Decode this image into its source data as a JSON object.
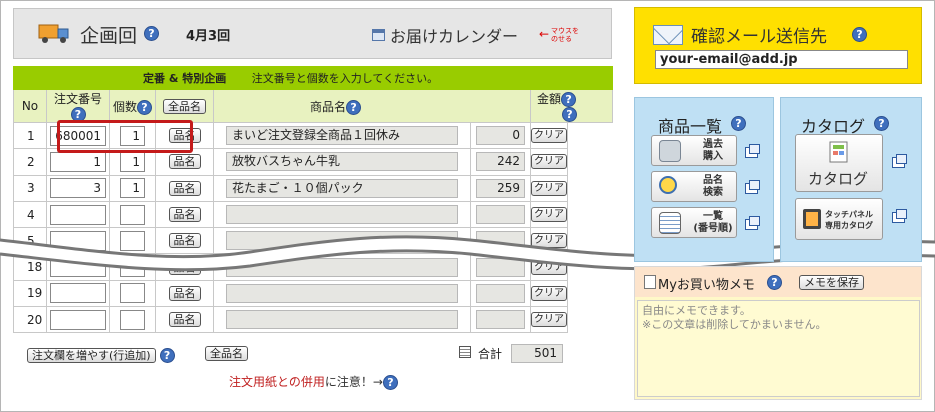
{
  "header": {
    "title": "企画回",
    "edition": "4月3回",
    "calendar_link": "お届けカレンダー",
    "calendar_arrow": "←",
    "calendar_hint": "マウスを\nのせる"
  },
  "order_form": {
    "banner_title": "定番 & 特別企画",
    "banner_instruction": "注文番号と個数を入力してください。",
    "columns": {
      "no": "No",
      "order_number": "注文番号",
      "quantity": "個数",
      "all_names_button": "全品名",
      "product_name": "商品名",
      "amount": "金額"
    },
    "name_button": "品名",
    "clear_button": "クリア",
    "rows": [
      {
        "no": "1",
        "order_number": "680001",
        "quantity": "1",
        "product_name": "まいど注文登録全商品１回休み",
        "amount": "0"
      },
      {
        "no": "2",
        "order_number": "1",
        "quantity": "1",
        "product_name": "放牧バスちゃん牛乳",
        "amount": "242"
      },
      {
        "no": "3",
        "order_number": "3",
        "quantity": "1",
        "product_name": "花たまご・１０個パック",
        "amount": "259"
      },
      {
        "no": "4",
        "order_number": "",
        "quantity": "",
        "product_name": "",
        "amount": ""
      },
      {
        "no": "5",
        "order_number": "",
        "quantity": "",
        "product_name": "",
        "amount": ""
      },
      {
        "no": "18",
        "order_number": "",
        "quantity": "",
        "product_name": "",
        "amount": ""
      },
      {
        "no": "19",
        "order_number": "",
        "quantity": "",
        "product_name": "",
        "amount": ""
      },
      {
        "no": "20",
        "order_number": "",
        "quantity": "",
        "product_name": "",
        "amount": ""
      }
    ],
    "add_rows_button": "注文欄を増やす(行追加)",
    "footer_all_names_button": "全品名",
    "total_label": "合計",
    "total_value": "501",
    "warning_red": "注文用紙との併用",
    "warning_rest": "に注意！→"
  },
  "help_icon": "?",
  "confirm_email": {
    "title": "確認メール送信先",
    "value": "your-email@add.jp"
  },
  "product_list": {
    "title": "商品一覧",
    "buttons": [
      {
        "label_line1": "過去",
        "label_line2": "購入",
        "icon": "basket-icon"
      },
      {
        "label_line1": "品名",
        "label_line2": "検索",
        "icon": "magnifier-icon"
      },
      {
        "label_line1": "一覧",
        "label_line2": "(番号順)",
        "icon": "list-icon"
      }
    ]
  },
  "catalog": {
    "title": "カタログ",
    "catalog_button": "カタログ",
    "touch_panel_line1": "タッチパネル",
    "touch_panel_line2": "専用カタログ"
  },
  "memo": {
    "title": "Myお買い物メモ",
    "save_button": "メモを保存",
    "placeholder": "自由にメモできます。\n※この文章は削除してかまいません。"
  },
  "colors": {
    "banner_green": "#99cc00",
    "email_yellow": "#ffe000",
    "panel_blue": "#bfe0f4",
    "highlight_red": "#c41a1a"
  }
}
